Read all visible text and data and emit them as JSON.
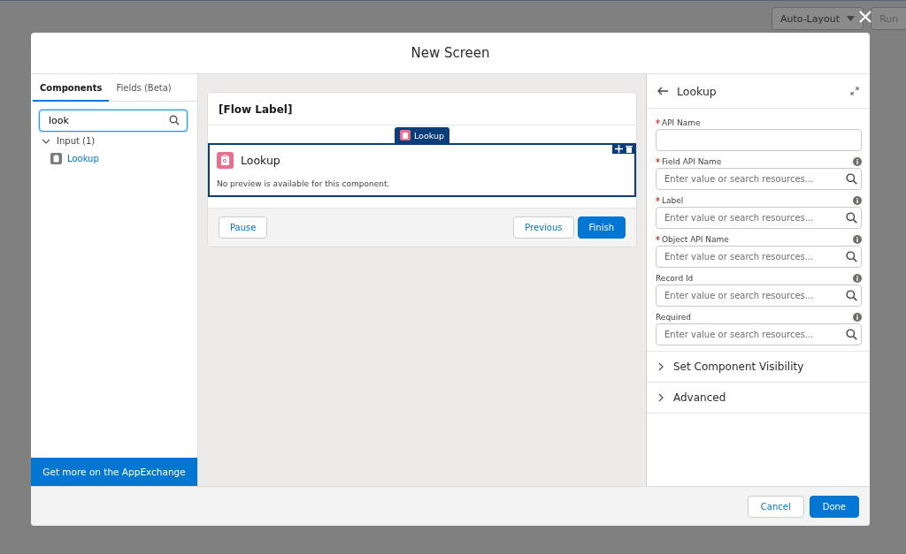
{
  "background": {
    "layout_button": "Auto-Layout",
    "run_button": "Run"
  },
  "modal": {
    "title": "New Screen"
  },
  "left_panel": {
    "tabs": [
      {
        "label": "Components",
        "selected": true
      },
      {
        "label": "Fields (Beta)",
        "selected": false
      }
    ],
    "search": {
      "value": "look"
    },
    "groups": [
      {
        "label": "Input (1)",
        "expanded": true,
        "children": [
          {
            "label": "Lookup"
          }
        ]
      }
    ],
    "appexchange_link": "Get more on the AppExchange"
  },
  "canvas": {
    "flow_label": "[Flow Label]",
    "component": {
      "tab_label": "Lookup",
      "title": "Lookup",
      "message": "No preview is available for this component.",
      "selected": true
    },
    "left_buttons": [
      {
        "label": "Pause",
        "kind": "neutral"
      }
    ],
    "right_buttons": [
      {
        "label": "Previous",
        "kind": "neutral"
      },
      {
        "label": "Finish",
        "kind": "brand"
      }
    ]
  },
  "properties": {
    "title": "Lookup",
    "fields": [
      {
        "label": "API Name",
        "required": true,
        "info": false,
        "kind": "text"
      },
      {
        "label": "Field API Name",
        "required": true,
        "info": true,
        "kind": "resource",
        "placeholder": "Enter value or search resources..."
      },
      {
        "label": "Label",
        "required": true,
        "info": true,
        "kind": "resource",
        "placeholder": "Enter value or search resources..."
      },
      {
        "label": "Object API Name",
        "required": true,
        "info": true,
        "kind": "resource",
        "placeholder": "Enter value or search resources..."
      },
      {
        "label": "Record Id",
        "required": false,
        "info": true,
        "kind": "resource",
        "placeholder": "Enter value or search resources..."
      },
      {
        "label": "Required",
        "required": false,
        "info": true,
        "kind": "resource",
        "placeholder": "Enter value or search resources..."
      }
    ],
    "sections": [
      {
        "label": "Set Component Visibility",
        "expanded": false
      },
      {
        "label": "Advanced",
        "expanded": false
      }
    ]
  },
  "footer": {
    "buttons": [
      {
        "label": "Cancel",
        "kind": "neutral"
      },
      {
        "label": "Done",
        "kind": "brand"
      }
    ]
  }
}
